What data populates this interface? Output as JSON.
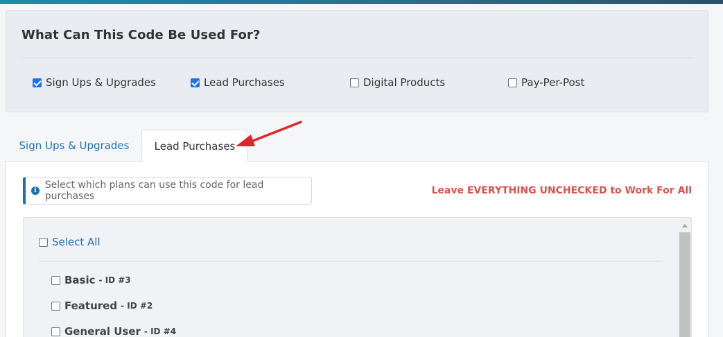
{
  "usage": {
    "title": "What Can This Code Be Used For?",
    "options": [
      {
        "label": "Sign Ups & Upgrades",
        "checked": true
      },
      {
        "label": "Lead Purchases",
        "checked": true
      },
      {
        "label": "Digital Products",
        "checked": false
      },
      {
        "label": "Pay-Per-Post",
        "checked": false
      }
    ]
  },
  "tabs": [
    {
      "label": "Sign Ups & Upgrades",
      "active": false
    },
    {
      "label": "Lead Purchases",
      "active": true
    }
  ],
  "lead_panel": {
    "info_note": "Select which plans can use this code for lead purchases",
    "warning": "Leave EVERYTHING UNCHECKED to Work For All",
    "select_all_label": "Select All",
    "plans": [
      {
        "name": "Basic",
        "id_text": "- ID #3",
        "checked": false
      },
      {
        "name": "Featured",
        "id_text": "- ID #2",
        "checked": false
      },
      {
        "name": "General User",
        "id_text": "- ID #4",
        "checked": false
      }
    ]
  },
  "colors": {
    "accent_blue": "#1d6fb8",
    "warning_red": "#d9534f",
    "annotation_arrow": "#e0262b"
  },
  "icons": [
    "info-icon",
    "checkbox-icon",
    "annotation-arrow-icon",
    "scroll-up-icon"
  ]
}
